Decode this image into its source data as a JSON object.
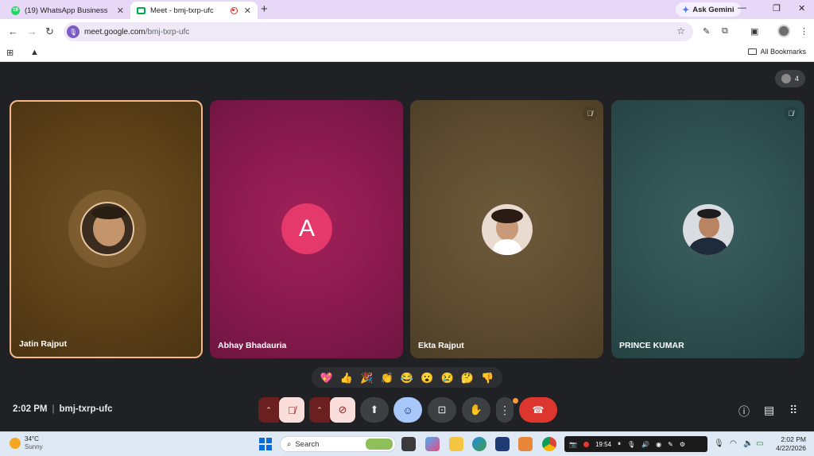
{
  "browser": {
    "tabs": [
      {
        "title": "(19) WhatsApp Business",
        "badge": "19",
        "close": "✕"
      },
      {
        "title": "Meet - bmj-txrp-ufc",
        "close": "✕"
      }
    ],
    "new_tab": "+",
    "ask_gemini": "Ask Gemini",
    "window_buttons": [
      "—",
      "❐",
      "✕"
    ],
    "url_host": "meet.google.com",
    "url_path": "/bmj-txrp-ufc",
    "all_bookmarks": "All Bookmarks"
  },
  "meet": {
    "participant_count": "4",
    "participants": [
      {
        "name": "Jatin Rajput",
        "muted": false,
        "speaking": true,
        "avatar": "photo"
      },
      {
        "name": "Abhay Bhadauria",
        "muted": false,
        "avatar": "initial",
        "initial": "A"
      },
      {
        "name": "Ekta Rajput",
        "muted": true,
        "avatar": "photo"
      },
      {
        "name": "PRINCE KUMAR",
        "muted": true,
        "avatar": "photo"
      }
    ],
    "reactions": [
      "💖",
      "👍",
      "🎉",
      "👏",
      "😂",
      "😮",
      "😢",
      "🤔",
      "👎"
    ],
    "time": "2:02 PM",
    "separator": "|",
    "meeting_code": "bmj-txrp-ufc",
    "colors": {
      "end_call": "#dc362e",
      "mic_off": "#f9dedc",
      "active_tile_border": "#f6b98d",
      "initial_avatar": "#e5396b"
    }
  },
  "taskbar": {
    "temperature": "34°C",
    "condition": "Sunny",
    "search_label": "Search",
    "recorder_time": "19:54",
    "time": "2:02 PM",
    "date": "4/22/2026"
  }
}
